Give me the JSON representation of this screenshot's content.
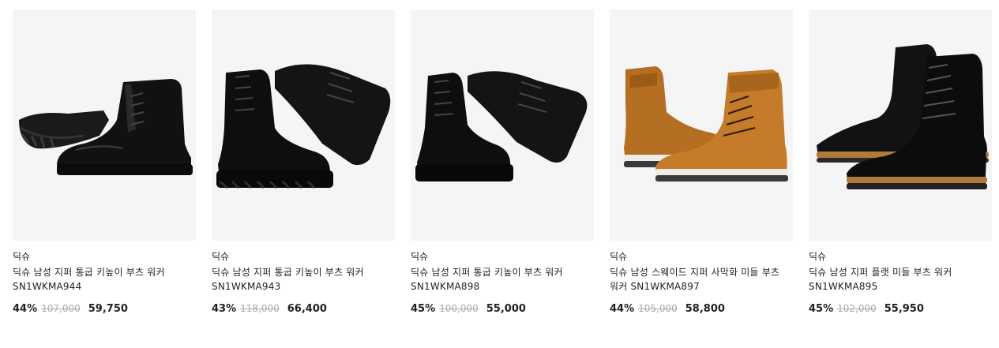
{
  "products": [
    {
      "image": "black-platform-boots-photo",
      "boot_color": "#111111",
      "brand": "딕슈",
      "name": "딕슈 남성 지퍼 통굽 키높이 부츠 워커 SN1WKMA944",
      "discount": "44%",
      "original_price": "107,000",
      "sale_price": "59,750"
    },
    {
      "image": "black-platform-boots-photo",
      "boot_color": "#111111",
      "brand": "딕슈",
      "name": "딕슈 남성 지퍼 통굽 키높이 부츠 워커 SN1WKMA943",
      "discount": "43%",
      "original_price": "118,000",
      "sale_price": "66,400"
    },
    {
      "image": "black-platform-boots-photo",
      "boot_color": "#111111",
      "brand": "딕슈",
      "name": "딕슈 남성 지퍼 통굽 키높이 부츠 워커 SN1WKMA898",
      "discount": "45%",
      "original_price": "100,000",
      "sale_price": "55,000"
    },
    {
      "image": "tan-suede-boots-photo",
      "boot_color": "#c07a2c",
      "brand": "딕슈",
      "name": "딕슈 남성 스웨이드 지퍼 사막화 미들 부츠 워커 SN1WKMA897",
      "discount": "44%",
      "original_price": "105,000",
      "sale_price": "58,800"
    },
    {
      "image": "black-flat-boots-photo",
      "boot_color": "#111111",
      "brand": "딕슈",
      "name": "딕슈 남성 지퍼 플랫 미들 부츠 워커 SN1WKMA895",
      "discount": "45%",
      "original_price": "102,000",
      "sale_price": "55,950"
    }
  ]
}
